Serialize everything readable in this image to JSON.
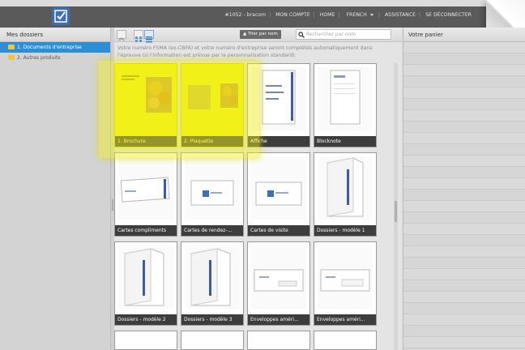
{
  "topbar": {
    "user": "#1052 - bracom",
    "nav": [
      "MON COMPTE",
      "HOME",
      "FRENCH",
      "ASSISTANCE",
      "SE DÉCONNECTER"
    ]
  },
  "sidebar": {
    "title": "Mes dossiers",
    "items": [
      {
        "label": "1. Documents d'entreprise",
        "active": true
      },
      {
        "label": "2. Autres produits",
        "active": false
      }
    ]
  },
  "toolbar": {
    "sort_label": "Trier par nom",
    "search_placeholder": "Rechercher par nom"
  },
  "notice": "Votre numéro FSMA (ex-CBFA) et votre numéro d'entreprise seront complétés automatiquement dans l'épreuve (si l'information est prévue par la personnalisation standard).",
  "products": [
    {
      "label": "1. Brochure",
      "highlight": true
    },
    {
      "label": "2. Plaquette",
      "highlight": true
    },
    {
      "label": "Affiche"
    },
    {
      "label": "Blocknote"
    },
    {
      "label": "Cartes compliments"
    },
    {
      "label": "Cartes de rendez-..."
    },
    {
      "label": "Cartes de visite"
    },
    {
      "label": "Dossiers - modèle 1"
    },
    {
      "label": "Dossiers - modèle 2"
    },
    {
      "label": "Dossiers - modèle 3"
    },
    {
      "label": "Enveloppes améri..."
    },
    {
      "label": "Enveloppes améri..."
    }
  ],
  "cart": {
    "title": "Votre panier"
  },
  "colors": {
    "accent": "#2c8fd6",
    "highlight": "#f4f31b",
    "label_bg": "#3d3d3d"
  }
}
